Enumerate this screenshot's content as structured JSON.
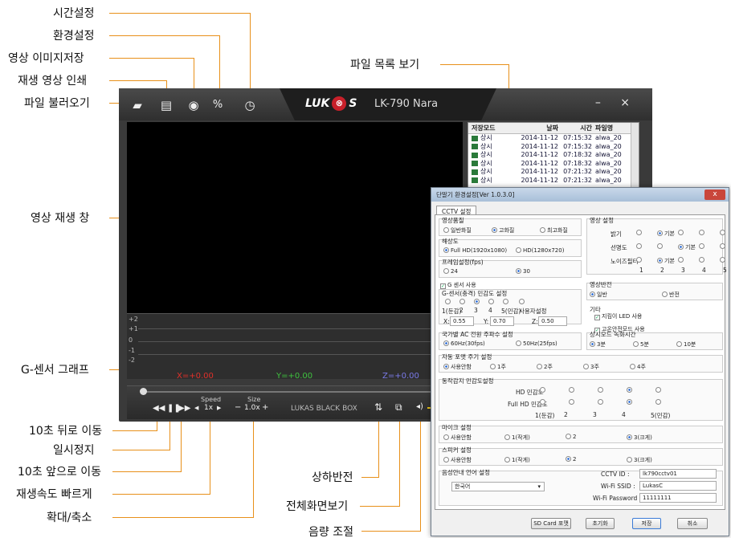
{
  "callouts": {
    "time_settings": "시간설정",
    "env_settings": "환경설정",
    "save_image": "영상 이미지저장",
    "print_video": "재생 영상 인쇄",
    "open_file": "파일 불러오기",
    "file_list": "파일 목록 보기",
    "video_window": "영상 재생 창",
    "gsensor_graph": "G-센서 그래프",
    "rewind": "10초 뒤로 이동",
    "pause": "일시정지",
    "forward": "10초 앞으로 이동",
    "speed_up": "재생속도 빠르게",
    "zoom": "확대/축소",
    "flip": "상하반전",
    "fullscreen": "전체화면보기",
    "volume": "음량 조절"
  },
  "player": {
    "brand": "LUK",
    "brand_tail": "S",
    "model": "LK-790 Nara",
    "window_controls": "– ×",
    "file_list": {
      "columns": [
        "저장모드",
        "날짜",
        "시간",
        "파일명"
      ],
      "rows": [
        [
          "상시",
          "2014-11-12",
          "07:15:32",
          "alwa_20"
        ],
        [
          "상시",
          "2014-11-12",
          "07:15:32",
          "alwa_20"
        ],
        [
          "상시",
          "2014-11-12",
          "07:18:32",
          "alwa_20"
        ],
        [
          "상시",
          "2014-11-12",
          "07:18:32",
          "alwa_20"
        ],
        [
          "상시",
          "2014-11-12",
          "07:21:32",
          "alwa_20"
        ],
        [
          "상시",
          "2014-11-12",
          "07:21:32",
          "alwa_20"
        ]
      ]
    },
    "graph": {
      "y_labels": [
        "+2",
        "+1",
        "0",
        "-1",
        "-2"
      ],
      "x_value": "X=+0.00",
      "y_value": "Y=+0.00",
      "z_value": "Z=+0.00"
    },
    "controls": {
      "speed_label": "Speed",
      "speed_value": "1x",
      "size_label": "Size",
      "size_value": "1.0x",
      "brand_box": "LUKAS BLACK BOX"
    },
    "colors": {
      "x": "#e0302a",
      "y": "#3fc23f",
      "z": "#7a7ae8",
      "accent": "#e8901a"
    }
  },
  "dialog": {
    "title": "단말기 환경설정[Ver 1.0.3.0]",
    "close": "x",
    "tab": "CCTV 설정",
    "video_quality": {
      "label": "영상품질",
      "options": [
        "일반화질",
        "고화질",
        "최고화질"
      ],
      "selected": 1
    },
    "resolution": {
      "label": "해상도",
      "options": [
        "Full HD(1920x1080)",
        "HD(1280x720)"
      ],
      "selected": 0
    },
    "fps": {
      "label": "프레임설정(fps)",
      "options": [
        "24",
        "30"
      ],
      "selected": 1
    },
    "image_settings": {
      "label": "영상 설정",
      "rows": [
        {
          "label": "밝기",
          "selected": 1,
          "tag": "기본"
        },
        {
          "label": "선명도",
          "selected": 2,
          "tag": "기본"
        },
        {
          "label": "노이즈필터",
          "selected": 1,
          "tag": "기본"
        }
      ],
      "scale": [
        "1",
        "2",
        "3",
        "4",
        "5"
      ]
    },
    "gsensor": {
      "enable_label": "G 센서 사용",
      "sens_label": "G-센서(충격) 민감도 설정",
      "scale": [
        "1(둔감)",
        "2",
        "3",
        "4",
        "5(민감)",
        "사용자설정"
      ],
      "selected": 2,
      "x_label": "X:",
      "x_value": "0.55",
      "y_label": "Y:",
      "y_value": "0.70",
      "z_label": "Z:",
      "z_value": "0.50"
    },
    "flip": {
      "label": "영상반전",
      "options": [
        "일반",
        "반전"
      ],
      "selected": 0
    },
    "etc": {
      "label": "기타",
      "led": "지킴이 LED 사용",
      "secure": "고온안전모드 사용"
    },
    "ac_freq": {
      "label": "국가별 AC 전원 주파수 설정",
      "options": [
        "60Hz(30fps)",
        "50Hz(25fps)"
      ],
      "selected": 0
    },
    "record_time": {
      "label": "상시모드 녹화시간",
      "options": [
        "3분",
        "5분",
        "10분"
      ],
      "selected": 0
    },
    "auto_format": {
      "label": "자동 포맷 주기 설정",
      "options": [
        "사용안함",
        "1주",
        "2주",
        "3주",
        "4주"
      ],
      "selected": 0
    },
    "motion": {
      "label": "동작감지 민감도설정",
      "hd_label": "HD 민감도",
      "fhd_label": "Full HD 민감도",
      "scale": [
        "1(둔감)",
        "2",
        "3",
        "4",
        "5(민감)"
      ],
      "hd_selected": 3,
      "fhd_selected": 3
    },
    "mic": {
      "label": "마이크 설정",
      "options": [
        "사용안함",
        "1(작게)",
        "2",
        "3(크게)"
      ],
      "selected": 3
    },
    "speaker": {
      "label": "스피커 설정",
      "options": [
        "사용안함",
        "1(작게)",
        "2",
        "3(크게)"
      ],
      "selected": 2
    },
    "voice": {
      "label": "음성안내 언어 설정",
      "value": "한국어"
    },
    "cctv_id": {
      "label": "CCTV ID :",
      "value": "lk790cctv01"
    },
    "ssid": {
      "label": "Wi-Fi SSID :",
      "value": "LukasC"
    },
    "password": {
      "label": "Wi-Fi Password :",
      "value": "11111111"
    },
    "buttons": {
      "sd_format": "SD Card 포맷",
      "reset": "초기화",
      "save": "저장",
      "cancel": "취소"
    }
  }
}
